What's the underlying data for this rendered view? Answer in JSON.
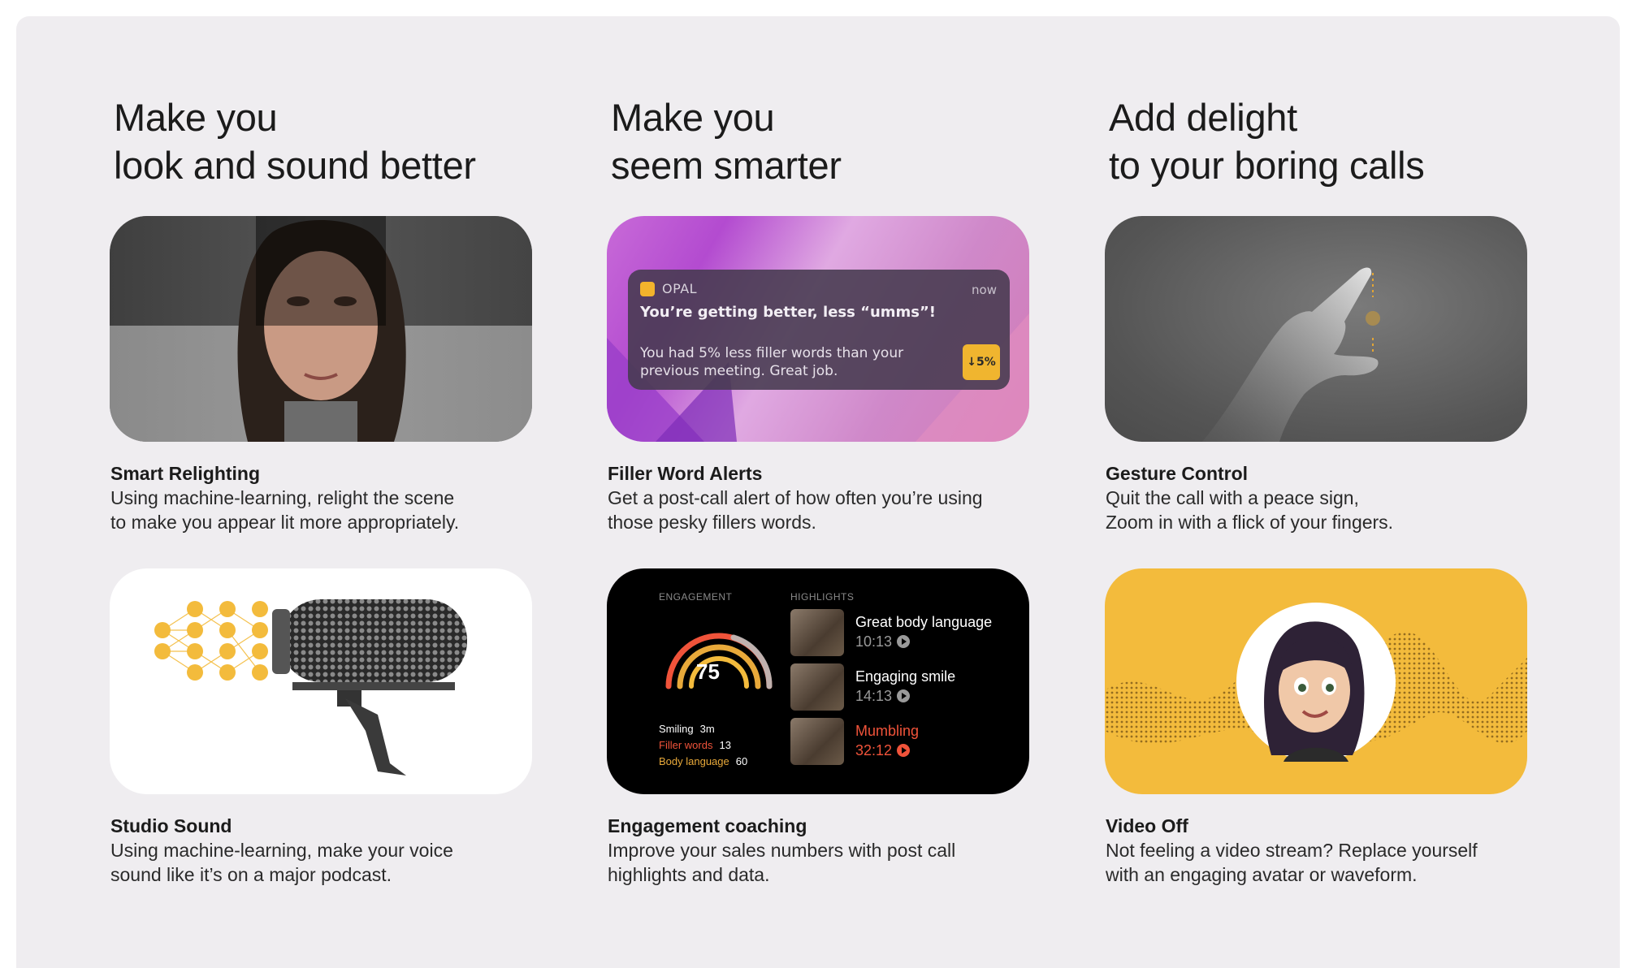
{
  "columns": [
    {
      "title_line1": "Make you",
      "title_line2": "look and sound better"
    },
    {
      "title_line1": "Make you",
      "title_line2": "seem smarter"
    },
    {
      "title_line1": "Add delight",
      "title_line2": "to your boring calls"
    }
  ],
  "features": [
    {
      "title": "Smart Relighting",
      "desc_line1": "Using machine-learning, relight the scene",
      "desc_line2": "to make you appear lit more appropriately."
    },
    {
      "title": "Filler Word Alerts",
      "desc_line1": "Get a post-call alert of how often you’re using",
      "desc_line2": "those pesky fillers words."
    },
    {
      "title": "Gesture Control",
      "desc_line1": "Quit the call with a peace sign,",
      "desc_line2": "Zoom in with a flick of your fingers."
    },
    {
      "title": "Studio Sound",
      "desc_line1": "Using machine-learning, make your voice",
      "desc_line2": "sound like it’s on a major podcast."
    },
    {
      "title": "Engagement coaching",
      "desc_line1": "Improve your sales numbers with post call",
      "desc_line2": "highlights and data."
    },
    {
      "title": "Video Off",
      "desc_line1": "Not feeling a video stream? Replace yourself",
      "desc_line2": "with an engaging avatar or waveform."
    }
  ],
  "notification": {
    "app": "OPAL",
    "time": "now",
    "headline": "You’re getting better, less “umms”!",
    "body": "You had 5% less filler words than your previous meeting. Great job.",
    "badge": "↓5%"
  },
  "engagement": {
    "engagement_label": "ENGAGEMENT",
    "highlights_label": "HIGHLIGHTS",
    "score": "75",
    "stats": [
      {
        "label": "Smiling",
        "value": "3m",
        "color": "#ffffff"
      },
      {
        "label": "Filler words",
        "value": "13",
        "color": "#f0533a"
      },
      {
        "label": "Body language",
        "value": "60",
        "color": "#e8a93a"
      }
    ],
    "highlights": [
      {
        "title": "Great body language",
        "time": "10:13"
      },
      {
        "title": "Engaging smile",
        "time": "14:13"
      },
      {
        "title": "Mumbling",
        "time": "32:12"
      }
    ]
  },
  "colors": {
    "panel": "#efedf0",
    "accent_yellow": "#f3bb3c",
    "alert_red": "#f0533a"
  },
  "icons": [
    "app-icon",
    "play-icon",
    "neural-net-icon",
    "microphone-icon",
    "hand-gesture-icon",
    "avatar-icon"
  ]
}
